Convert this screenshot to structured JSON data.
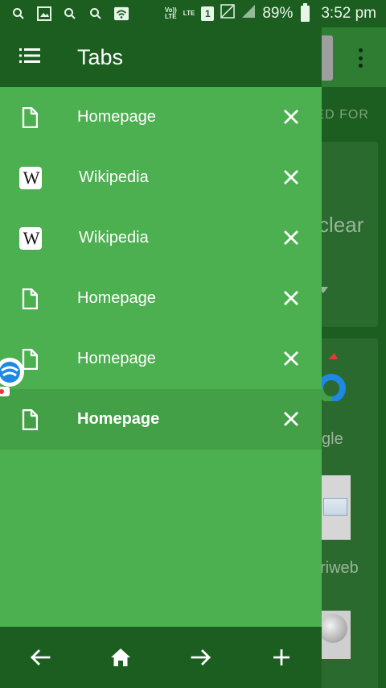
{
  "status_bar": {
    "volte": "Vo))\nLTE",
    "lte": "LTE",
    "sim": "1",
    "battery_percent": "89%",
    "time": "3:52 pm"
  },
  "background_app": {
    "suggested_text": "STED FOR",
    "clear_text": "clear",
    "google_label": "gle",
    "riweb_label": "riweb"
  },
  "drawer": {
    "title": "Tabs",
    "tabs": [
      {
        "title": "Homepage",
        "icon": "page-icon",
        "active": false
      },
      {
        "title": "Wikipedia",
        "icon": "wikipedia-icon",
        "active": false
      },
      {
        "title": "Wikipedia",
        "icon": "wikipedia-icon",
        "active": false
      },
      {
        "title": "Homepage",
        "icon": "page-icon",
        "active": false
      },
      {
        "title": "Homepage",
        "icon": "page-icon",
        "active": false
      },
      {
        "title": "Homepage",
        "icon": "page-icon",
        "active": true
      }
    ]
  },
  "bottom_bar": {
    "buttons": [
      "back-icon",
      "home-icon",
      "forward-icon",
      "add-icon"
    ]
  },
  "colors": {
    "drawer_bg": "#4caf50",
    "header_bg": "#1b5e20",
    "active_row": "#43a047"
  }
}
